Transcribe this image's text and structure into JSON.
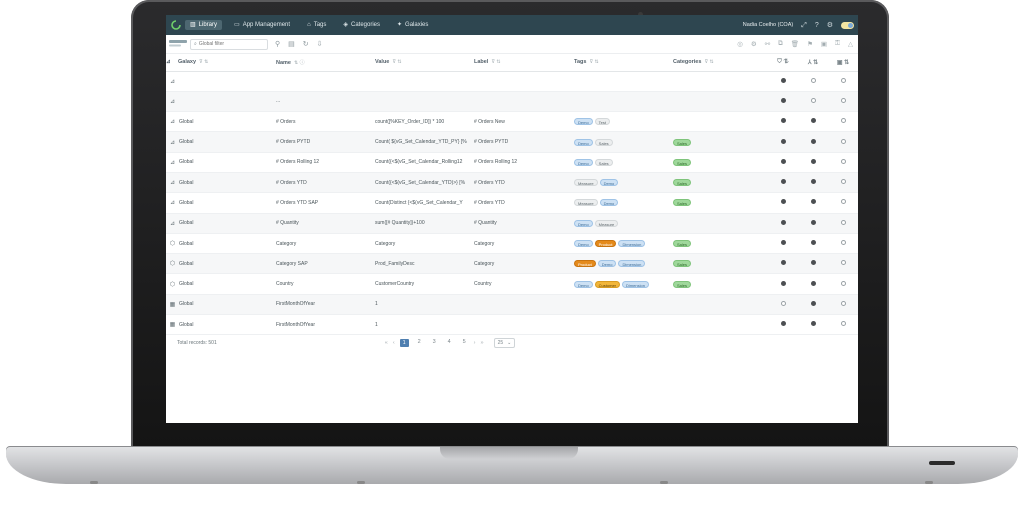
{
  "app": {
    "nav": [
      {
        "label": "Library",
        "icon": "library-icon",
        "active": true
      },
      {
        "label": "App Management",
        "icon": "app-icon",
        "active": false
      },
      {
        "label": "Tags",
        "icon": "tag-icon",
        "active": false
      },
      {
        "label": "Categories",
        "icon": "categories-icon",
        "active": false
      },
      {
        "label": "Galaxies",
        "icon": "galaxy-icon",
        "active": false
      }
    ],
    "user": "Nadia Coelho (COA)"
  },
  "toolbar": {
    "search_placeholder": "Global filter"
  },
  "columns": {
    "galaxy": "Galaxy",
    "name": "Name",
    "value": "Value",
    "label": "Label",
    "tags": "Tags",
    "categories": "Categories"
  },
  "rows": [
    {
      "icon": "measure-icon",
      "galaxy": "",
      "name": "",
      "value": "",
      "label": "",
      "tags": [],
      "categories": [],
      "flags": [
        true,
        false,
        false
      ]
    },
    {
      "icon": "measure-icon",
      "galaxy": "",
      "name": "...",
      "value": "",
      "label": "",
      "tags": [],
      "categories": [],
      "flags": [
        true,
        false,
        false
      ]
    },
    {
      "icon": "measure-icon",
      "galaxy": "Global",
      "name": "# Orders",
      "value": "count([%KEY_Order_ID]) * 100",
      "label": "# Orders New",
      "tags": [
        {
          "t": "Demo",
          "c": "blue"
        },
        {
          "t": "Test",
          "c": "grey"
        }
      ],
      "categories": [],
      "flags": [
        true,
        true,
        false
      ]
    },
    {
      "icon": "measure-icon",
      "galaxy": "Global",
      "name": "# Orders PYTD",
      "value": "Count( ${vG_Set_Calendar_YTD_PY} [%",
      "label": "# Orders PYTD",
      "tags": [
        {
          "t": "Demo",
          "c": "blue"
        },
        {
          "t": "Sales",
          "c": "grey"
        }
      ],
      "categories": [
        {
          "t": "Sales",
          "c": "green"
        }
      ],
      "flags": [
        true,
        true,
        false
      ]
    },
    {
      "icon": "measure-icon",
      "galaxy": "Global",
      "name": "# Orders Rolling 12",
      "value": "Count({<$(vG_Set_Calendar_Rolling12",
      "label": "# Orders Rolling 12",
      "tags": [
        {
          "t": "Demo",
          "c": "blue"
        },
        {
          "t": "Sales",
          "c": "grey"
        }
      ],
      "categories": [
        {
          "t": "Sales",
          "c": "green"
        }
      ],
      "flags": [
        true,
        true,
        false
      ]
    },
    {
      "icon": "measure-icon",
      "galaxy": "Global",
      "name": "# Orders YTD",
      "value": "Count({<$(vG_Set_Calendar_YTD)>} [%",
      "label": "# Orders YTD",
      "tags": [
        {
          "t": "Measure",
          "c": "grey"
        },
        {
          "t": "Demo",
          "c": "blue"
        }
      ],
      "categories": [
        {
          "t": "Sales",
          "c": "green"
        }
      ],
      "flags": [
        true,
        true,
        false
      ]
    },
    {
      "icon": "measure-icon",
      "galaxy": "Global",
      "name": "# Orders YTD SAP",
      "value": "Count(Distinct {<$(vG_Set_Calendar_Y",
      "label": "# Orders YTD",
      "tags": [
        {
          "t": "Measure",
          "c": "grey"
        },
        {
          "t": "Demo",
          "c": "blue"
        }
      ],
      "categories": [
        {
          "t": "Sales",
          "c": "green"
        }
      ],
      "flags": [
        true,
        true,
        false
      ]
    },
    {
      "icon": "measure-icon",
      "galaxy": "Global",
      "name": "# Quantity",
      "value": "sum([# Quantity])+100",
      "label": "# Quantity",
      "tags": [
        {
          "t": "Demo",
          "c": "blue"
        },
        {
          "t": "Measure",
          "c": "grey"
        }
      ],
      "categories": [],
      "flags": [
        true,
        true,
        false
      ]
    },
    {
      "icon": "dimension-icon",
      "galaxy": "Global",
      "name": "Category",
      "value": "Category",
      "label": "Category",
      "tags": [
        {
          "t": "Demo",
          "c": "blue"
        },
        {
          "t": "Product",
          "c": "orange"
        },
        {
          "t": "Dimension",
          "c": "blue"
        }
      ],
      "categories": [
        {
          "t": "Sales",
          "c": "green"
        }
      ],
      "flags": [
        true,
        true,
        false
      ]
    },
    {
      "icon": "dimension-icon",
      "galaxy": "Global",
      "name": "Category SAP",
      "value": "Prod_FamilyDesc",
      "label": "Category",
      "tags": [
        {
          "t": "Product",
          "c": "orange"
        },
        {
          "t": "Demo",
          "c": "blue"
        },
        {
          "t": "Dimension",
          "c": "blue"
        }
      ],
      "categories": [
        {
          "t": "Sales",
          "c": "green"
        }
      ],
      "flags": [
        true,
        true,
        false
      ]
    },
    {
      "icon": "dimension-icon",
      "galaxy": "Global",
      "name": "Country",
      "value": "CustomerCountry",
      "label": "Country",
      "tags": [
        {
          "t": "Demo",
          "c": "blue"
        },
        {
          "t": "Customer",
          "c": "yellow"
        },
        {
          "t": "Dimension",
          "c": "blue"
        }
      ],
      "categories": [
        {
          "t": "Sales",
          "c": "green"
        }
      ],
      "flags": [
        true,
        true,
        false
      ]
    },
    {
      "icon": "calendar-icon",
      "galaxy": "Global",
      "name": "FirstMonthOfYear",
      "value": "1",
      "label": "",
      "tags": [],
      "categories": [],
      "flags": [
        false,
        true,
        false
      ]
    },
    {
      "icon": "calendar-icon",
      "galaxy": "Global",
      "name": "FirstMonthOfYear",
      "value": "1",
      "label": "",
      "tags": [],
      "categories": [],
      "flags": [
        true,
        true,
        false
      ]
    }
  ],
  "footer": {
    "total": "Total records: 501",
    "pages": [
      "1",
      "2",
      "3",
      "4",
      "5"
    ],
    "page_size": "25"
  },
  "colors": {
    "topbar": "#2e4650",
    "accent": "#4f7fb0"
  }
}
